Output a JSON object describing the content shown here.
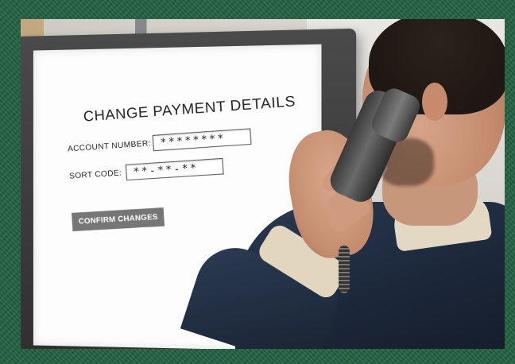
{
  "screen": {
    "title": "CHANGE PAYMENT DETAILS",
    "account_label": "ACCOUNT NUMBER:",
    "account_value": "********",
    "sort_label": "SORT CODE:",
    "sort_value": "**-**-**",
    "confirm_label": "CONFIRM CHANGES"
  },
  "colors": {
    "frame": "#21603f",
    "button": "#767676",
    "screen": "#fdfdfd",
    "jacket": "#1b2638"
  }
}
